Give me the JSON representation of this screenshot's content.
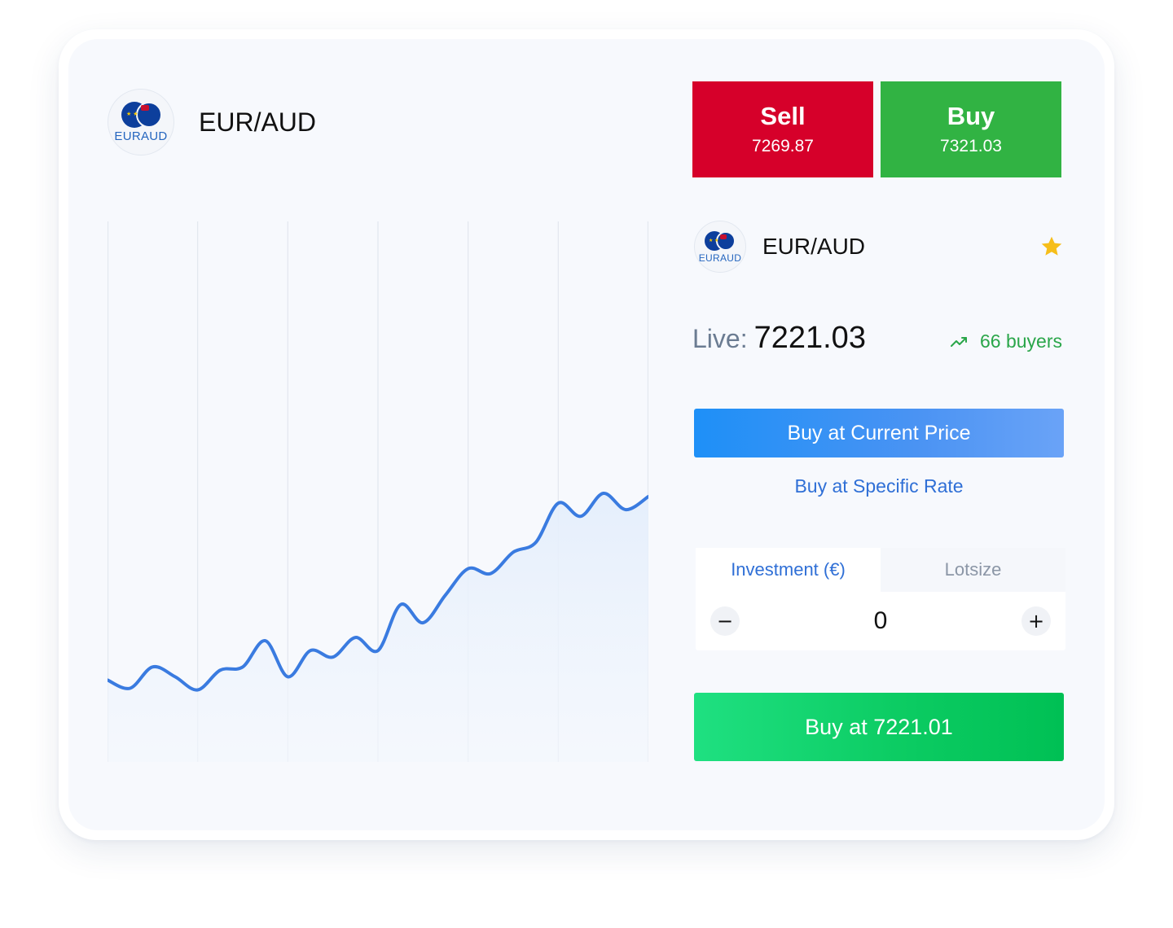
{
  "header": {
    "pair": "EUR/AUD",
    "flag_caption": "EURAUD",
    "flag_icon": "eur-aud-flag-icon"
  },
  "sell": {
    "label": "Sell",
    "value": "7269.87",
    "color": "#d6002a"
  },
  "buy": {
    "label": "Buy",
    "value": "7321.03",
    "color": "#31b343"
  },
  "panel": {
    "pair": "EUR/AUD",
    "flag_caption": "EURAUD",
    "favorite_icon": "star-icon",
    "live_label": "Live:",
    "live_value": "7221.03",
    "buyers_icon": "trend-up-icon",
    "buyers_text": "66 buyers",
    "buy_current_label": "Buy at Current Price",
    "buy_specific_label": "Buy at Specific Rate",
    "tabs": [
      {
        "label": "Investment (€)",
        "active": true
      },
      {
        "label": "Lotsize",
        "active": false
      }
    ],
    "quantity": "0",
    "minus_symbol": "−",
    "plus_symbol": "+",
    "final_buy_label": "Buy at 7221.01"
  },
  "chart_data": {
    "type": "area",
    "x": [
      0,
      0.25,
      0.5,
      0.75,
      1.0,
      1.25,
      1.5,
      1.75,
      2.0,
      2.25,
      2.5,
      2.75,
      3.0,
      3.25,
      3.5,
      3.75,
      4.0,
      4.25,
      4.5,
      4.75,
      5.0,
      5.25,
      5.5,
      5.75,
      6.0
    ],
    "values": [
      20,
      15,
      28,
      22,
      14,
      26,
      28,
      44,
      22,
      38,
      34,
      46,
      38,
      66,
      55,
      72,
      88,
      85,
      98,
      104,
      128,
      120,
      134,
      124,
      132
    ],
    "xlim": [
      0,
      6
    ],
    "ylim": [
      -30,
      300
    ],
    "vertical_grid": true,
    "line_color": "#3a7be0",
    "fill_color": "#eaf2fd"
  }
}
